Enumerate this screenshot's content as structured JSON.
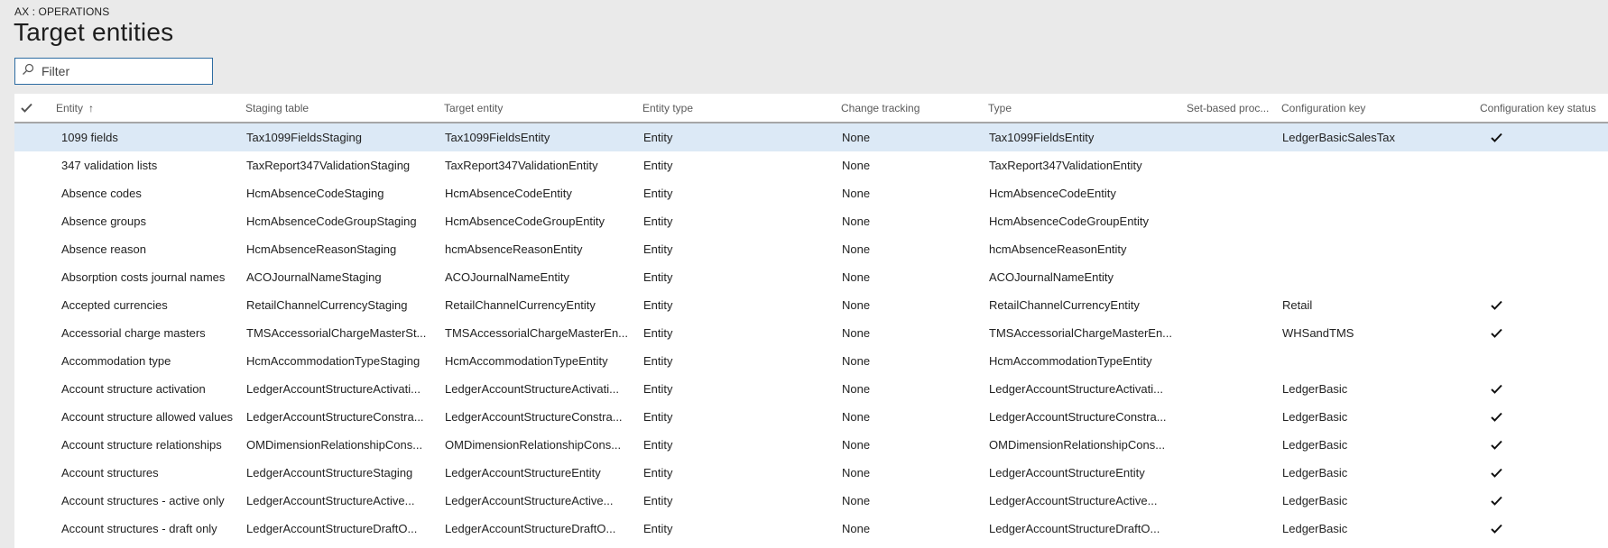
{
  "header": {
    "caption": "AX : OPERATIONS",
    "title": "Target entities"
  },
  "filter": {
    "placeholder": "Filter",
    "value": "",
    "icon": "search-icon"
  },
  "grid": {
    "columns": [
      {
        "key": "entity",
        "label": "Entity",
        "sort": "ascending"
      },
      {
        "key": "staging_table",
        "label": "Staging table"
      },
      {
        "key": "target_entity",
        "label": "Target entity"
      },
      {
        "key": "entity_type",
        "label": "Entity type"
      },
      {
        "key": "change_tracking",
        "label": "Change tracking"
      },
      {
        "key": "type",
        "label": "Type"
      },
      {
        "key": "set_based",
        "label": "Set-based proc..."
      },
      {
        "key": "config_key",
        "label": "Configuration key"
      },
      {
        "key": "config_key_status",
        "label": "Configuration key status"
      }
    ],
    "sort_arrow": "↑",
    "selected_row": 0,
    "rows": [
      {
        "entity": "1099 fields",
        "staging_table": "Tax1099FieldsStaging",
        "target_entity": "Tax1099FieldsEntity",
        "entity_type": "Entity",
        "change_tracking": "None",
        "type": "Tax1099FieldsEntity",
        "set_based": "",
        "config_key": "LedgerBasicSalesTax",
        "config_key_status": true
      },
      {
        "entity": "347 validation lists",
        "staging_table": "TaxReport347ValidationStaging",
        "target_entity": "TaxReport347ValidationEntity",
        "entity_type": "Entity",
        "change_tracking": "None",
        "type": "TaxReport347ValidationEntity",
        "set_based": "",
        "config_key": "",
        "config_key_status": false
      },
      {
        "entity": "Absence codes",
        "staging_table": "HcmAbsenceCodeStaging",
        "target_entity": "HcmAbsenceCodeEntity",
        "entity_type": "Entity",
        "change_tracking": "None",
        "type": "HcmAbsenceCodeEntity",
        "set_based": "",
        "config_key": "",
        "config_key_status": false
      },
      {
        "entity": "Absence groups",
        "staging_table": "HcmAbsenceCodeGroupStaging",
        "target_entity": "HcmAbsenceCodeGroupEntity",
        "entity_type": "Entity",
        "change_tracking": "None",
        "type": "HcmAbsenceCodeGroupEntity",
        "set_based": "",
        "config_key": "",
        "config_key_status": false
      },
      {
        "entity": "Absence reason",
        "staging_table": "HcmAbsenceReasonStaging",
        "target_entity": "hcmAbsenceReasonEntity",
        "entity_type": "Entity",
        "change_tracking": "None",
        "type": "hcmAbsenceReasonEntity",
        "set_based": "",
        "config_key": "",
        "config_key_status": false
      },
      {
        "entity": "Absorption costs journal names",
        "staging_table": "ACOJournalNameStaging",
        "target_entity": "ACOJournalNameEntity",
        "entity_type": "Entity",
        "change_tracking": "None",
        "type": "ACOJournalNameEntity",
        "set_based": "",
        "config_key": "",
        "config_key_status": false
      },
      {
        "entity": "Accepted currencies",
        "staging_table": "RetailChannelCurrencyStaging",
        "target_entity": "RetailChannelCurrencyEntity",
        "entity_type": "Entity",
        "change_tracking": "None",
        "type": "RetailChannelCurrencyEntity",
        "set_based": "",
        "config_key": "Retail",
        "config_key_status": true
      },
      {
        "entity": "Accessorial charge masters",
        "staging_table": "TMSAccessorialChargeMasterSt...",
        "target_entity": "TMSAccessorialChargeMasterEn...",
        "entity_type": "Entity",
        "change_tracking": "None",
        "type": "TMSAccessorialChargeMasterEn...",
        "set_based": "",
        "config_key": "WHSandTMS",
        "config_key_status": true
      },
      {
        "entity": "Accommodation type",
        "staging_table": "HcmAccommodationTypeStaging",
        "target_entity": "HcmAccommodationTypeEntity",
        "entity_type": "Entity",
        "change_tracking": "None",
        "type": "HcmAccommodationTypeEntity",
        "set_based": "",
        "config_key": "",
        "config_key_status": false
      },
      {
        "entity": "Account structure activation",
        "staging_table": "LedgerAccountStructureActivati...",
        "target_entity": "LedgerAccountStructureActivati...",
        "entity_type": "Entity",
        "change_tracking": "None",
        "type": "LedgerAccountStructureActivati...",
        "set_based": "",
        "config_key": "LedgerBasic",
        "config_key_status": true
      },
      {
        "entity": "Account structure allowed values",
        "staging_table": "LedgerAccountStructureConstra...",
        "target_entity": "LedgerAccountStructureConstra...",
        "entity_type": "Entity",
        "change_tracking": "None",
        "type": "LedgerAccountStructureConstra...",
        "set_based": "",
        "config_key": "LedgerBasic",
        "config_key_status": true
      },
      {
        "entity": "Account structure relationships",
        "staging_table": "OMDimensionRelationshipCons...",
        "target_entity": "OMDimensionRelationshipCons...",
        "entity_type": "Entity",
        "change_tracking": "None",
        "type": "OMDimensionRelationshipCons...",
        "set_based": "",
        "config_key": "LedgerBasic",
        "config_key_status": true
      },
      {
        "entity": "Account structures",
        "staging_table": "LedgerAccountStructureStaging",
        "target_entity": "LedgerAccountStructureEntity",
        "entity_type": "Entity",
        "change_tracking": "None",
        "type": "LedgerAccountStructureEntity",
        "set_based": "",
        "config_key": "LedgerBasic",
        "config_key_status": true
      },
      {
        "entity": "Account structures - active only",
        "staging_table": "LedgerAccountStructureActive...",
        "target_entity": "LedgerAccountStructureActive...",
        "entity_type": "Entity",
        "change_tracking": "None",
        "type": "LedgerAccountStructureActive...",
        "set_based": "",
        "config_key": "LedgerBasic",
        "config_key_status": true
      },
      {
        "entity": "Account structures - draft only",
        "staging_table": "LedgerAccountStructureDraftO...",
        "target_entity": "LedgerAccountStructureDraftO...",
        "entity_type": "Entity",
        "change_tracking": "None",
        "type": "LedgerAccountStructureDraftO...",
        "set_based": "",
        "config_key": "LedgerBasic",
        "config_key_status": true
      }
    ]
  },
  "colors": {
    "background": "#eaeaea",
    "selected_row": "#dce9f6",
    "accent_border": "#2d6ca2"
  }
}
